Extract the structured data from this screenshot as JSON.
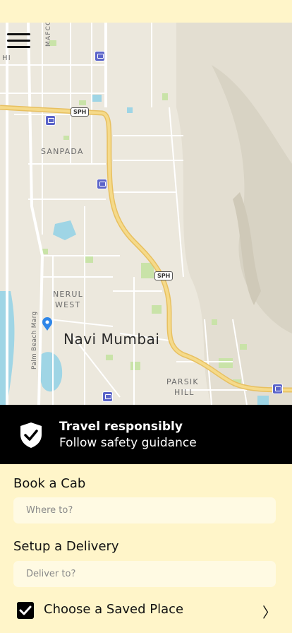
{
  "map": {
    "labels": {
      "city": "Navi Mumbai",
      "sanpada": "SANPADA",
      "nerul": "NERUL",
      "west": "WEST",
      "parsik": "PARSIK",
      "hill": "HILL",
      "palm_beach": "Palm Beach Marg",
      "mafco": "MAFCO",
      "hi": "HI"
    },
    "highway_shields": [
      "SPH",
      "SPH"
    ],
    "colors": {
      "land": "#ECE8DD",
      "water": "#9FD5E5",
      "highway": "#F2D27A",
      "park": "#C9E3A8",
      "pin": "#2F86E8"
    }
  },
  "banner": {
    "icon": "shield-check-icon",
    "title": "Travel responsibly",
    "subtitle": "Follow safety guidance"
  },
  "book": {
    "title": "Book a Cab",
    "placeholder": "Where to?"
  },
  "delivery": {
    "title": "Setup a Delivery",
    "placeholder": "Deliver to?"
  },
  "saved": {
    "label": "Choose a Saved Place",
    "checked": true
  }
}
